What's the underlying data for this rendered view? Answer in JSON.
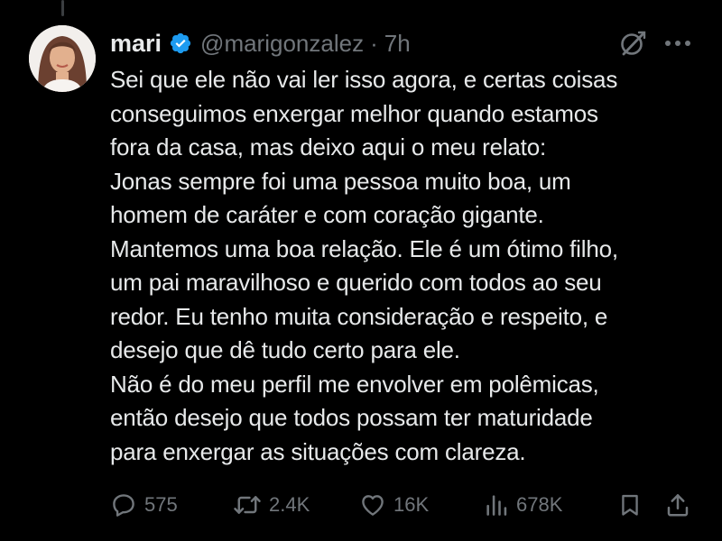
{
  "tweet": {
    "display_name": "mari",
    "handle": "@marigonzalez",
    "separator": "·",
    "time": "7h",
    "verified": true,
    "lines": [
      "Sei que ele não vai ler isso agora, e certas coisas",
      "conseguimos enxergar melhor quando estamos",
      "fora da casa, mas deixo aqui o meu relato:",
      "Jonas sempre foi uma pessoa muito boa, um",
      "homem de caráter e com coração gigante.",
      "Mantemos uma boa relação. Ele é um ótimo filho,",
      "um pai maravilhoso e querido com todos ao seu",
      "redor. Eu tenho muita consideração e respeito, e",
      "desejo que dê tudo certo para ele.",
      "Não é do meu perfil me envolver em polêmicas,",
      "então desejo que todos possam ter maturidade",
      "para enxergar as situações com clareza."
    ]
  },
  "actions": {
    "replies": "575",
    "reposts": "2.4K",
    "likes": "16K",
    "views": "678K"
  },
  "icons": {
    "verified": "verified-badge-icon",
    "grok": "grok-icon",
    "more": "more-icon",
    "reply": "reply-icon",
    "repost": "repost-icon",
    "like": "heart-icon",
    "views": "views-icon",
    "bookmark": "bookmark-icon",
    "share": "share-icon"
  },
  "colors": {
    "background": "#000000",
    "text": "#e7e9ea",
    "muted": "#71767b",
    "verified": "#1d9bf0"
  }
}
